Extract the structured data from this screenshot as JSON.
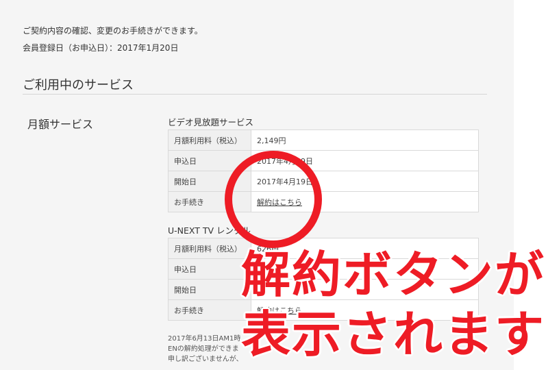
{
  "intro": {
    "description": "ご契約内容の確認、変更のお手続きができます。",
    "registration": "会員登録日（お申込日）：2017年1月20日"
  },
  "section": {
    "title": "ご利用中のサービス",
    "category": "月額サービス"
  },
  "services": [
    {
      "title": "ビデオ見放題サービス",
      "rows": [
        {
          "label": "月額利用料（税込）",
          "value": "2,149円"
        },
        {
          "label": "申込日",
          "value": "2017年4月19日"
        },
        {
          "label": "開始日",
          "value": "2017年4月19日"
        },
        {
          "label": "お手続き",
          "value": "解約はこちら"
        }
      ]
    },
    {
      "title": "U-NEXT TV レンタル",
      "rows": [
        {
          "label": "月額利用料（税込）",
          "value": "626円"
        },
        {
          "label": "申込日",
          "value": ""
        },
        {
          "label": "開始日",
          "value": ""
        },
        {
          "label": "お手続き",
          "value": "解約はこちら"
        }
      ]
    }
  ],
  "notice": {
    "line1": "2017年6月13日AM1時",
    "line2": "ENの解約処理ができま",
    "line3": "申し訳ございませんが、"
  },
  "overlay": {
    "line1": "解約ボタンが",
    "line2": "表示されます",
    "color": "#ee1c25"
  }
}
